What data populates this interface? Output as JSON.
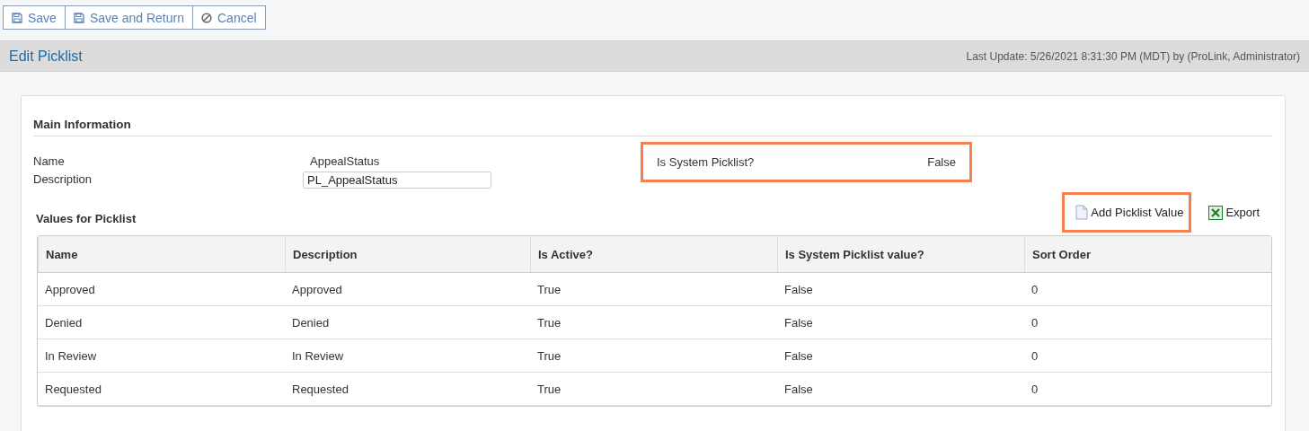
{
  "toolbar": [
    {
      "label": "Save",
      "kind": "save"
    },
    {
      "label": "Save and Return",
      "kind": "save"
    },
    {
      "label": "Cancel",
      "kind": "cancel"
    }
  ],
  "header": {
    "title": "Edit Picklist",
    "last_update": "Last Update: 5/26/2021 8:31:30 PM (MDT) by (ProLink, Administrator)"
  },
  "section_title": "Main Information",
  "name": {
    "label": "Name",
    "value": "AppealStatus"
  },
  "description": {
    "label": "Description",
    "value": "PL_AppealStatus"
  },
  "system_picklist": {
    "label": "Is System Picklist?",
    "value": "False",
    "highlighted": true
  },
  "values_title": "Values for Picklist",
  "actions": [
    {
      "label": "Add Picklist Value",
      "kind": "add",
      "highlighted": true
    },
    {
      "label": "Export",
      "kind": "export",
      "highlighted": false
    }
  ],
  "table": {
    "columns": [
      "Name",
      "Description",
      "Is Active?",
      "Is System Picklist value?",
      "Sort Order"
    ],
    "rows": [
      [
        "Approved",
        "Approved",
        "True",
        "False",
        "0"
      ],
      [
        "Denied",
        "Denied",
        "True",
        "False",
        "0"
      ],
      [
        "In Review",
        "In Review",
        "True",
        "False",
        "0"
      ],
      [
        "Requested",
        "Requested",
        "True",
        "False",
        "0"
      ]
    ]
  }
}
